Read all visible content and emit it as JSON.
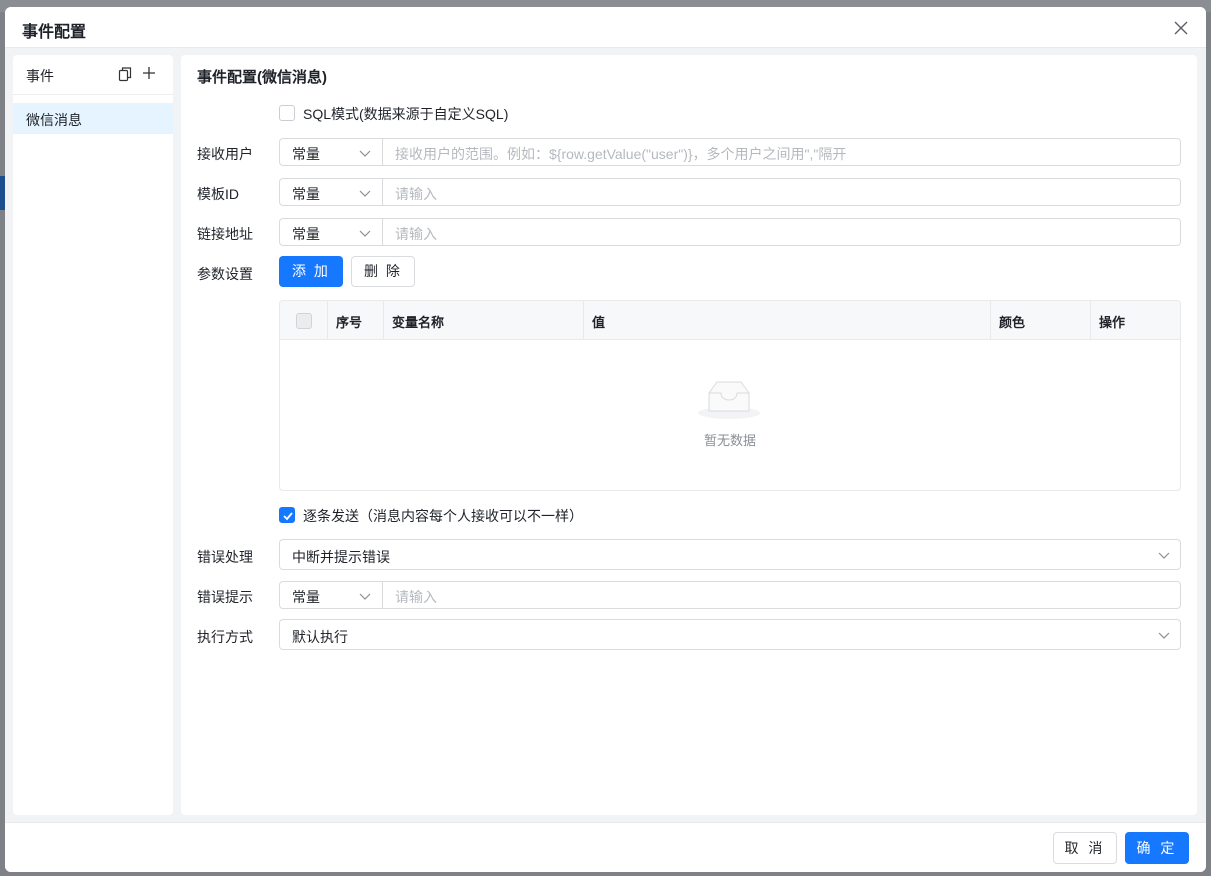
{
  "modal": {
    "title": "事件配置"
  },
  "left": {
    "header": "事件",
    "items": [
      {
        "label": "微信消息"
      }
    ]
  },
  "main": {
    "title": "事件配置(微信消息)",
    "sql_mode": {
      "label": "SQL模式(数据来源于自定义SQL)",
      "checked": false
    },
    "fields": {
      "receiver": {
        "label": "接收用户",
        "type": "常量",
        "placeholder": "接收用户的范围。例如：${row.getValue(\"user\")}，多个用户之间用\",\"隔开"
      },
      "template": {
        "label": "模板ID",
        "type": "常量",
        "placeholder": "请输入"
      },
      "link": {
        "label": "链接地址",
        "type": "常量",
        "placeholder": "请输入"
      }
    },
    "params": {
      "label": "参数设置",
      "add_label": "添 加",
      "delete_label": "删 除",
      "columns": [
        "序号",
        "变量名称",
        "值",
        "颜色",
        "操作"
      ],
      "rows": [],
      "empty_text": "暂无数据"
    },
    "send_one_by_one": {
      "label": "逐条发送（消息内容每个人接收可以不一样）",
      "checked": true
    },
    "error_handling": {
      "label": "错误处理",
      "value": "中断并提示错误"
    },
    "error_tip": {
      "label": "错误提示",
      "type": "常量",
      "placeholder": "请输入"
    },
    "exec_mode": {
      "label": "执行方式",
      "value": "默认执行"
    }
  },
  "footer": {
    "cancel_label": "取 消",
    "ok_label": "确 定"
  },
  "colors": {
    "primary": "#1677ff",
    "selected_bg": "#e6f4ff"
  }
}
